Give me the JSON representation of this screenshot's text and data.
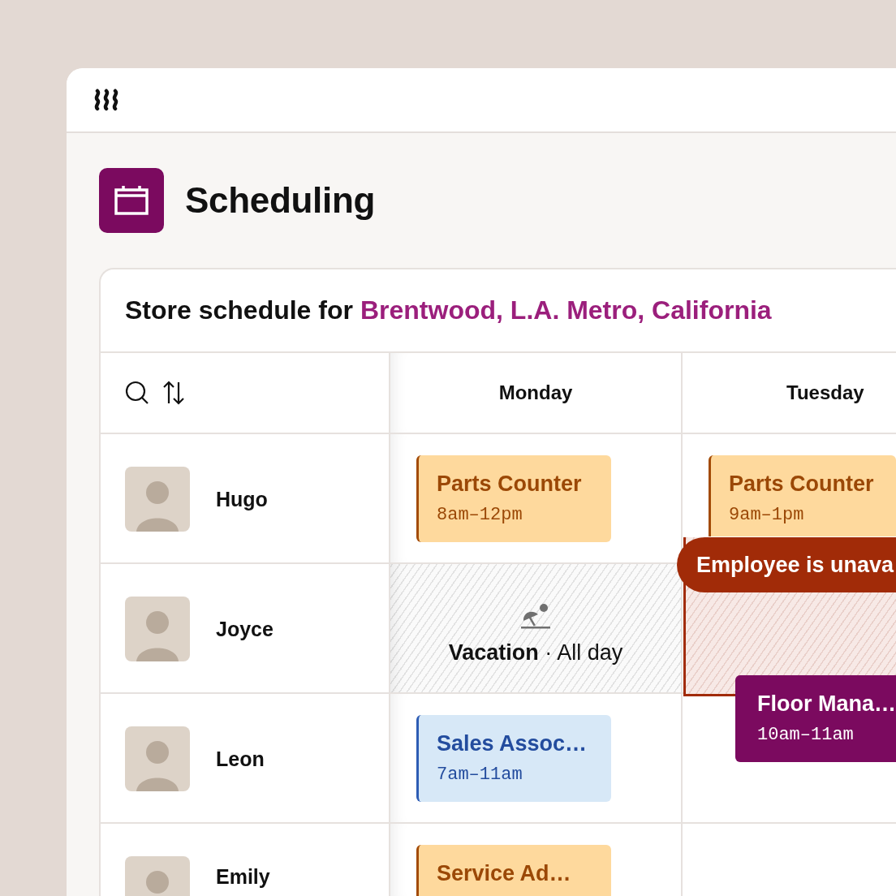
{
  "app": {
    "title": "Scheduling"
  },
  "schedule": {
    "title_prefix": "Store schedule for",
    "location": "Brentwood, L.A. Metro, California",
    "days": [
      "Monday",
      "Tuesday"
    ],
    "rows": [
      {
        "name": "Hugo",
        "cells": [
          {
            "kind": "shift",
            "title": "Parts Counter",
            "time": "8am–12pm",
            "color": "#a34b06"
          },
          {
            "kind": "shift",
            "title": "Parts Counter",
            "time": "9am–1pm",
            "color": "#a34b06"
          }
        ]
      },
      {
        "name": "Joyce",
        "cells": [
          {
            "kind": "vacation",
            "text": "**Vacation** · All day"
          },
          {
            "kind": "empty"
          }
        ]
      },
      {
        "name": "Leon",
        "cells": [
          {
            "kind": "shift",
            "title": "Sales Assoc…",
            "time": "7am–11am",
            "color": "#2d5cb4"
          },
          {
            "kind": "empty"
          }
        ]
      },
      {
        "name": "Emily",
        "cells": [
          {
            "kind": "shift",
            "title": "Service Ad…",
            "color": "#a34b06"
          },
          {
            "kind": "empty"
          }
        ]
      }
    ],
    "unavailable": {
      "message": "Employee is unava"
    },
    "floating_shift": {
      "title": "Floor Mana…",
      "time": "10am–11am",
      "color": "#7b0a5f"
    }
  }
}
